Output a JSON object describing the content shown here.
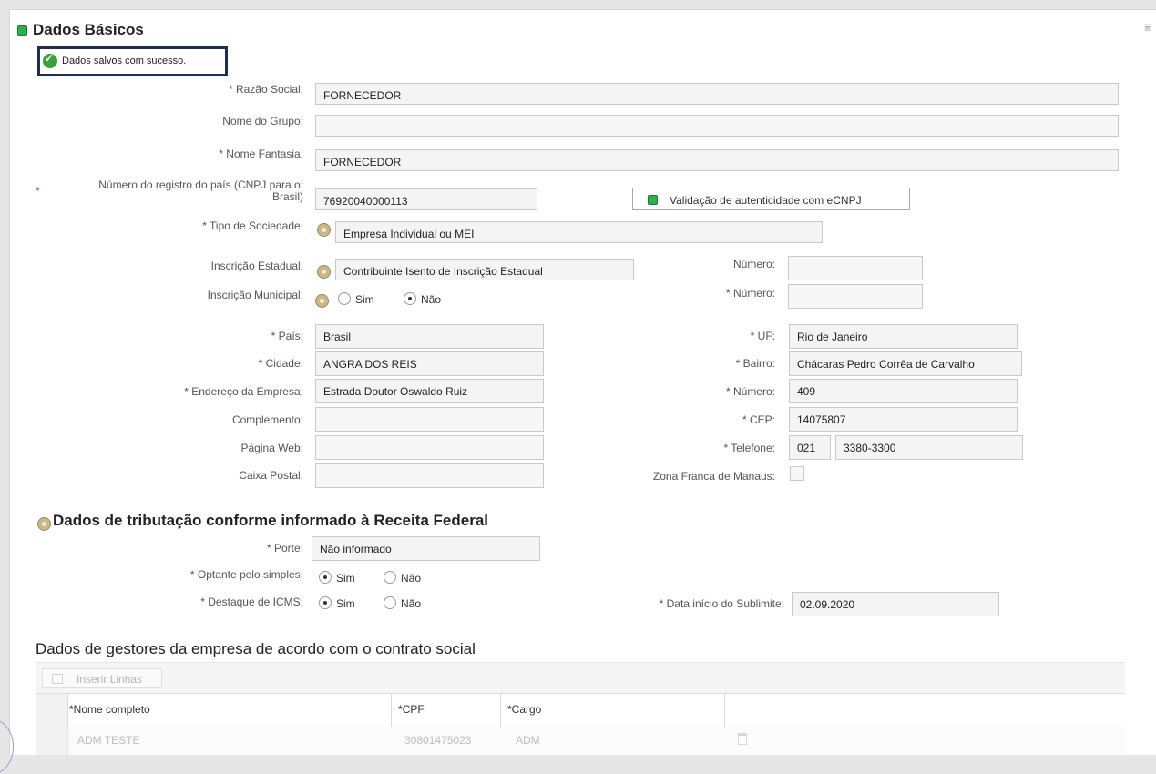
{
  "header": {
    "title": "Dados Básicos"
  },
  "success_message": "Dados salvos com sucesso.",
  "company": {
    "razao_social_label": "* Razão Social:",
    "razao_social_value": "FORNECEDOR",
    "nome_grupo_label": "Nome do Grupo:",
    "nome_grupo_value": "",
    "nome_fantasia_label": "* Nome Fantasia:",
    "nome_fantasia_value": "FORNECEDOR",
    "registro_label_line1": "Número do registro do país (CNPJ para o:",
    "registro_label_line2": "Brasil)",
    "registro_asterisk": "*",
    "registro_value": "76920040000113",
    "validacao_button": "Validação de autenticidade com eCNPJ",
    "tipo_sociedade_label": "* Tipo de Sociedade:",
    "tipo_sociedade_value": "Empresa Individual ou MEI",
    "inscricao_estadual_label": "Inscrição Estadual:",
    "inscricao_estadual_value": "Contribuinte Isento de Inscrição Estadual",
    "numero_ie_label": "Número:",
    "inscricao_municipal_label": "Inscrição Municipal:",
    "im_sim": "Sim",
    "im_nao": "Não",
    "numero_im_label": "* Número:"
  },
  "address": {
    "pais_label": "* País:",
    "pais_value": "Brasil",
    "cidade_label": "* Cidade:",
    "cidade_value": "ANGRA DOS REIS",
    "endereco_label": "* Endereço da Empresa:",
    "endereco_value": "Estrada Doutor Oswaldo Ruiz",
    "complemento_label": "Complemento:",
    "pagina_web_label": "Página Web:",
    "caixa_postal_label": "Caixa Postal:",
    "uf_label": "* UF:",
    "uf_value": "Rio de Janeiro",
    "bairro_label": "* Bairro:",
    "bairro_value": "Chácaras Pedro Corrêa de Carvalho",
    "numero_label": "* Número:",
    "numero_value": "409",
    "cep_label": "* CEP:",
    "cep_value": "14075807",
    "telefone_label": "* Telefone:",
    "telefone_ddd": "021",
    "telefone_value": "3380-3300",
    "zona_franca_label": "Zona Franca de Manaus:"
  },
  "tributacao": {
    "title": "Dados de tributação conforme informado à Receita Federal",
    "porte_label": "* Porte:",
    "porte_value": "Não informado",
    "simples_label": "* Optante pelo simples:",
    "icms_label": "* Destaque de ICMS:",
    "sim": "Sim",
    "nao": "Não",
    "sublimite_label": "* Data início do Sublimite:",
    "sublimite_value": "02.09.2020"
  },
  "gestores": {
    "title": "Dados de gestores da empresa de acordo com o contrato social",
    "insert_button": "Inserir Linhas",
    "columns": [
      "*Nome completo",
      "*CPF",
      "*Cargo"
    ],
    "rows": [
      {
        "nome": "ADM TESTE",
        "cpf": "30801475023",
        "cargo": "ADM"
      }
    ]
  }
}
